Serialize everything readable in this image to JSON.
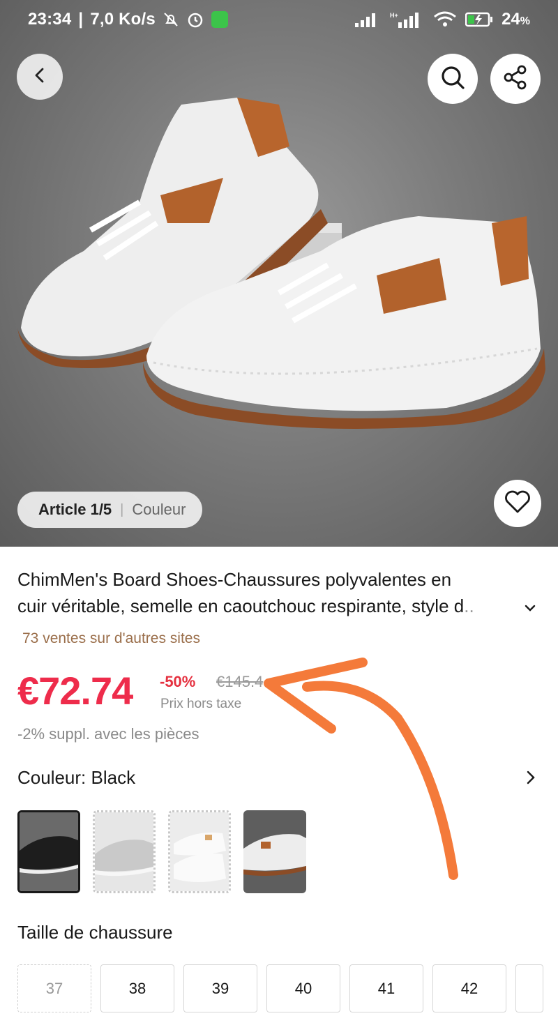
{
  "status_bar": {
    "time": "23:34",
    "speed": "7,0 Ko/s",
    "battery": "24",
    "battery_unit": "%"
  },
  "hero": {
    "article_label": "Article 1/5",
    "separator": "|",
    "color_label": "Couleur",
    "icons": [
      "back-arrow-icon",
      "search-icon",
      "share-icon",
      "heart-icon"
    ]
  },
  "product": {
    "title_line1": "ChimMen's Board Shoes-Chaussures polyvalentes en",
    "title_line2": "cuir véritable, semelle en caoutchouc respirante, style d",
    "title_ellipsis": "..",
    "sales": "73 ventes sur d'autres sites",
    "price": "€72.74",
    "discount": "-50%",
    "original_price": "€145.4",
    "tax_note": "Prix hors taxe",
    "coins_note": "-2% suppl. avec les pièces"
  },
  "color_selector": {
    "label": "Couleur: Black",
    "options": [
      "black",
      "gray",
      "white",
      "white-brown"
    ],
    "selected": 0
  },
  "size_selector": {
    "label": "Taille de chaussure",
    "sizes": [
      "37",
      "38",
      "39",
      "40",
      "41",
      "42"
    ],
    "disabled": [
      "37"
    ]
  },
  "colors": {
    "price_red": "#ee2c4b",
    "sales_brown": "#9a6e4a",
    "annotation_orange": "#f47a3a"
  }
}
